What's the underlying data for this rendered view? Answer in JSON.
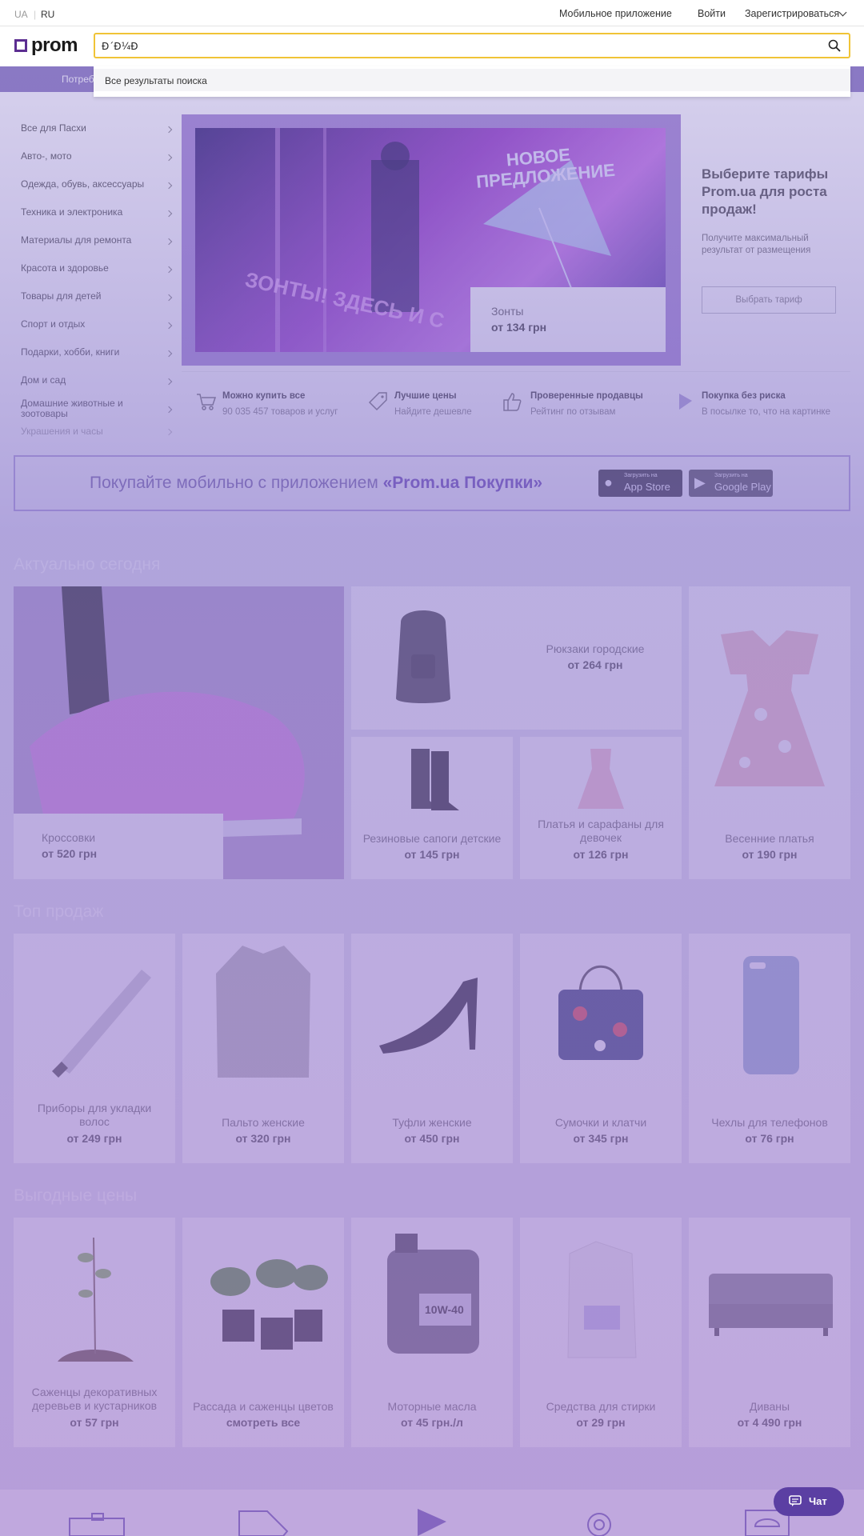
{
  "topbar": {
    "lang_ua": "UA",
    "lang_ru": "RU",
    "mobile_app": "Мобильное приложение",
    "login": "Войти",
    "register": "Зарегистрироваться"
  },
  "header": {
    "logo": "prom",
    "search_value": "Ð´Ð¼Ð",
    "dropdown_all_results": "Все результаты поиска",
    "nav_partial": "Потреб"
  },
  "sidebar": {
    "items": [
      {
        "label": "Все для Пасхи"
      },
      {
        "label": "Авто-, мото"
      },
      {
        "label": "Одежда, обувь, аксессуары"
      },
      {
        "label": "Техника и электроника"
      },
      {
        "label": "Материалы для ремонта"
      },
      {
        "label": "Красота и здоровье"
      },
      {
        "label": "Товары для детей"
      },
      {
        "label": "Спорт и отдых"
      },
      {
        "label": "Подарки, хобби, книги"
      },
      {
        "label": "Дом и сад"
      },
      {
        "label": "Домашние животные и зоотовары"
      },
      {
        "label": "Украшения и часы"
      }
    ]
  },
  "banner": {
    "image_text": "НОВОЕ ПРЕДЛОЖЕНИЕ",
    "image_text2": "ЗОНТЫ! ЗДЕСЬ И С",
    "card_title": "Зонты",
    "card_price": "от 134 грн"
  },
  "promo": {
    "title": "Выберите тарифы Prom.ua для роста продаж!",
    "subtitle": "Получите максимальный результат от размещения",
    "button": "Выбрать тариф"
  },
  "features": [
    {
      "title": "Можно купить все",
      "sub": "90 035 457 товаров и услуг",
      "icon": "cart-icon"
    },
    {
      "title": "Лучшие цены",
      "sub": "Найдите дешевле",
      "icon": "tag-icon"
    },
    {
      "title": "Проверенные продавцы",
      "sub": "Рейтинг по отзывам",
      "icon": "thumbs-up-icon"
    },
    {
      "title": "Покупка без риска",
      "sub": "В посылке то, что на картинке",
      "icon": "shield-icon"
    }
  ],
  "app_banner": {
    "text": "Покупайте мобильно с приложением ",
    "brand": "«Prom.ua Покупки»",
    "appstore_small": "Загрузить на",
    "appstore_big": "App Store",
    "gplay_small": "Загрузить на",
    "gplay_big": "Google Play"
  },
  "sections": {
    "actual": {
      "title": "Актуально сегодня",
      "items": [
        {
          "name": "Кроссовки",
          "price": "от 520 грн"
        },
        {
          "name": "Рюкзаки городские",
          "price": "от 264 грн"
        },
        {
          "name": "Весенние платья",
          "price": "от 190 грн"
        },
        {
          "name": "Резиновые сапоги детские",
          "price": "от 145 грн"
        },
        {
          "name": "Платья и сарафаны для девочек",
          "price": "от 126 грн"
        }
      ]
    },
    "top": {
      "title": "Топ продаж",
      "items": [
        {
          "name": "Приборы для укладки волос",
          "price": "от 249 грн"
        },
        {
          "name": "Пальто женские",
          "price": "от 320 грн"
        },
        {
          "name": "Туфли женские",
          "price": "от 450 грн"
        },
        {
          "name": "Сумочки и клатчи",
          "price": "от 345 грн"
        },
        {
          "name": "Чехлы для телефонов",
          "price": "от 76 грн"
        }
      ]
    },
    "deals": {
      "title": "Выгодные цены",
      "items": [
        {
          "name": "Саженцы декоративных деревьев и кустарников",
          "price": "от 57 грн"
        },
        {
          "name": "Рассада и саженцы цветов",
          "price": "смотреть все"
        },
        {
          "name": "Моторные масла",
          "price": "от 45 грн./л"
        },
        {
          "name": "Средства для стирки",
          "price": "от 29 грн"
        },
        {
          "name": "Диваны",
          "price": "от 4 490 грн"
        }
      ]
    }
  },
  "chat": {
    "label": "Чат"
  },
  "colors": {
    "brand": "#5c2e91",
    "search_border": "#f0c437",
    "chat": "#5b3fa3"
  }
}
